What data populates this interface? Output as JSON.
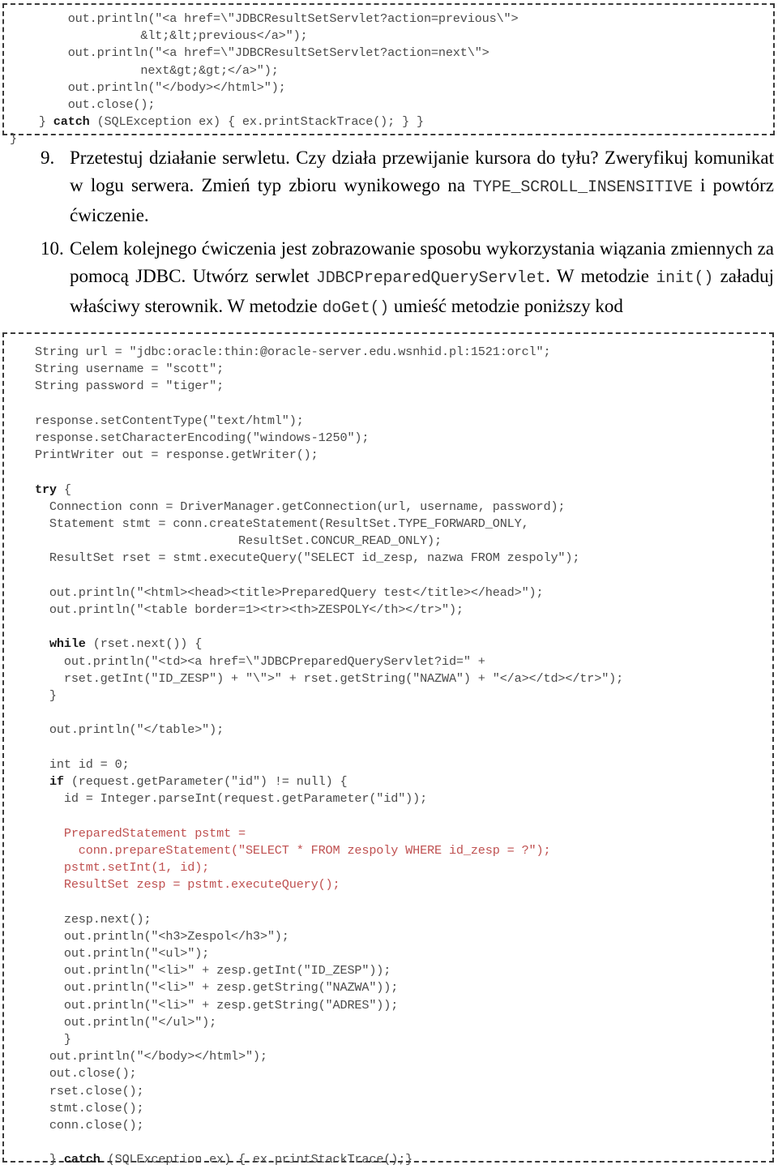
{
  "document": {
    "language": "pl",
    "colors": {
      "code_text": "#4a4a4a",
      "code_keyword": "#1a1a1a",
      "code_highlight_red": "#bf5050",
      "frame_border": "#3a3a3a",
      "page_background": "#ffffff"
    }
  },
  "code_block_top": {
    "name": "jdbc-resultset-servlet-tail",
    "lines": [
      "        out.println(\"<a href=\\\"JDBCResultSetServlet?action=previous\\\">",
      "                  &lt;&lt;previous</a>\");",
      "        out.println(\"<a href=\\\"JDBCResultSetServlet?action=next\\\">",
      "                  next&gt;&gt;</a>\");",
      "        out.println(\"</body></html>\");",
      "        out.close();",
      "    } catch (SQLException ex) { ex.printStackTrace(); } }",
      "}"
    ],
    "keyword_line_index": 6,
    "keyword": "catch"
  },
  "list": {
    "items": [
      {
        "number": "9.",
        "segments": [
          {
            "type": "text",
            "value": "Przetestuj działanie serwletu. Czy działa przewijanie kursora do tyłu? Zweryfikuj komunikat w logu serwera. Zmień typ zbioru wynikowego na "
          },
          {
            "type": "mono",
            "value": "TYPE_SCROLL_INSENSITIVE"
          },
          {
            "type": "text",
            "value": " i powtórz ćwiczenie."
          }
        ],
        "plain": "Przetestuj działanie serwletu. Czy działa przewijanie kursora do tyłu? Zweryfikuj komunikat w logu serwera. Zmień typ zbioru wynikowego na TYPE_SCROLL_INSENSITIVE i powtórz ćwiczenie."
      },
      {
        "number": "10.",
        "segments": [
          {
            "type": "text",
            "value": "Celem kolejnego ćwiczenia jest zobrazowanie sposobu wykorzystania wiązania zmiennych za pomocą JDBC. Utwórz serwlet "
          },
          {
            "type": "mono",
            "value": "JDBCPreparedQueryServlet"
          },
          {
            "type": "text",
            "value": ". W metodzie "
          },
          {
            "type": "mono",
            "value": "init()"
          },
          {
            "type": "text",
            "value": " załaduj właściwy sterownik. W metodzie "
          },
          {
            "type": "mono",
            "value": "doGet()"
          },
          {
            "type": "text",
            "value": " umieść metodzie poniższy kod"
          }
        ],
        "plain": "Celem kolejnego ćwiczenia jest zobrazowanie sposobu wykorzystania wiązania zmiennych za pomocą JDBC. Utwórz serwlet JDBCPreparedQueryServlet. W metodzie init() załaduj właściwy sterownik. W metodzie doGet() umieść metodzie poniższy kod"
      }
    ]
  },
  "code_block_bottom": {
    "name": "jdbc-prepared-query-servlet-doget",
    "lines": [
      {
        "text": "String url = \"jdbc:oracle:thin:@oracle-server.edu.wsnhid.pl:1521:orcl\";",
        "style": "plain"
      },
      {
        "text": "String username = \"scott\";",
        "style": "plain"
      },
      {
        "text": "String password = \"tiger\";",
        "style": "plain"
      },
      {
        "text": "",
        "style": "blank"
      },
      {
        "text": "response.setContentType(\"text/html\");",
        "style": "plain"
      },
      {
        "text": "response.setCharacterEncoding(\"windows-1250\");",
        "style": "plain"
      },
      {
        "text": "PrintWriter out = response.getWriter();",
        "style": "plain"
      },
      {
        "text": "",
        "style": "blank"
      },
      {
        "text": "try {",
        "style": "keyword-lead",
        "keyword": "try"
      },
      {
        "text": "  Connection conn = DriverManager.getConnection(url, username, password);",
        "style": "plain"
      },
      {
        "text": "  Statement stmt = conn.createStatement(ResultSet.TYPE_FORWARD_ONLY,",
        "style": "plain"
      },
      {
        "text": "                            ResultSet.CONCUR_READ_ONLY);",
        "style": "plain"
      },
      {
        "text": "  ResultSet rset = stmt.executeQuery(\"SELECT id_zesp, nazwa FROM zespoly\");",
        "style": "plain"
      },
      {
        "text": "",
        "style": "blank"
      },
      {
        "text": "  out.println(\"<html><head><title>PreparedQuery test</title></head>\");",
        "style": "plain"
      },
      {
        "text": "  out.println(\"<table border=1><tr><th>ZESPOLY</th></tr>\");",
        "style": "plain"
      },
      {
        "text": "",
        "style": "blank"
      },
      {
        "text": "  while (rset.next()) {",
        "style": "keyword-lead",
        "keyword": "while"
      },
      {
        "text": "    out.println(\"<td><a href=\\\"JDBCPreparedQueryServlet?id=\" +",
        "style": "plain"
      },
      {
        "text": "    rset.getInt(\"ID_ZESP\") + \"\\\">\" + rset.getString(\"NAZWA\") + \"</a></td></tr>\");",
        "style": "plain"
      },
      {
        "text": "  }",
        "style": "plain"
      },
      {
        "text": "",
        "style": "blank"
      },
      {
        "text": "  out.println(\"</table>\");",
        "style": "plain"
      },
      {
        "text": "",
        "style": "blank"
      },
      {
        "text": "  int id = 0;",
        "style": "plain"
      },
      {
        "text": "  if (request.getParameter(\"id\") != null) {",
        "style": "keyword-lead",
        "keyword": "if"
      },
      {
        "text": "    id = Integer.parseInt(request.getParameter(\"id\"));",
        "style": "plain"
      },
      {
        "text": "",
        "style": "blank"
      },
      {
        "text": "    PreparedStatement pstmt =",
        "style": "red"
      },
      {
        "text": "      conn.prepareStatement(\"SELECT * FROM zespoly WHERE id_zesp = ?\");",
        "style": "red"
      },
      {
        "text": "    pstmt.setInt(1, id);",
        "style": "red"
      },
      {
        "text": "    ResultSet zesp = pstmt.executeQuery();",
        "style": "red"
      },
      {
        "text": "",
        "style": "blank"
      },
      {
        "text": "    zesp.next();",
        "style": "plain"
      },
      {
        "text": "    out.println(\"<h3>Zespol</h3>\");",
        "style": "plain"
      },
      {
        "text": "    out.println(\"<ul>\");",
        "style": "plain"
      },
      {
        "text": "    out.println(\"<li>\" + zesp.getInt(\"ID_ZESP\"));",
        "style": "plain"
      },
      {
        "text": "    out.println(\"<li>\" + zesp.getString(\"NAZWA\"));",
        "style": "plain"
      },
      {
        "text": "    out.println(\"<li>\" + zesp.getString(\"ADRES\"));",
        "style": "plain"
      },
      {
        "text": "    out.println(\"</ul>\");",
        "style": "plain"
      },
      {
        "text": "    }",
        "style": "plain"
      },
      {
        "text": "  out.println(\"</body></html>\");",
        "style": "plain"
      },
      {
        "text": "  out.close();",
        "style": "plain"
      },
      {
        "text": "  rset.close();",
        "style": "plain"
      },
      {
        "text": "  stmt.close();",
        "style": "plain"
      },
      {
        "text": "  conn.close();",
        "style": "plain"
      },
      {
        "text": "",
        "style": "blank"
      },
      {
        "text": "  } catch (SQLException ex) { ex.printStackTrace();}",
        "style": "keyword-catch",
        "keyword": "catch"
      }
    ]
  }
}
